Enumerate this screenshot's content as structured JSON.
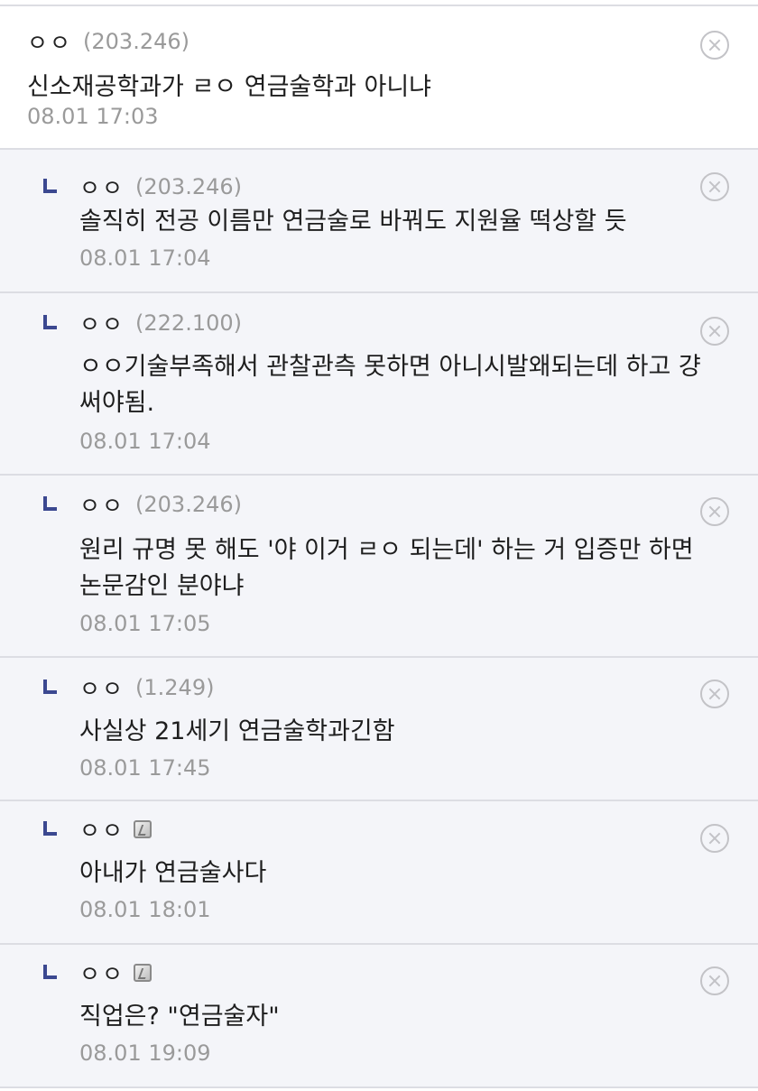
{
  "comments": [
    {
      "type": "top",
      "nick": "ㅇㅇ",
      "ip": "(203.246)",
      "text": "신소재공학과가 ㄹㅇ 연금술학과 아니냐",
      "date": "08.01 17:03"
    },
    {
      "type": "reply",
      "nick": "ㅇㅇ",
      "ip": "(203.246)",
      "text": "솔직히 전공 이름만 연금술로 바꿔도 지원율 떡상할 듯",
      "date": "08.01 17:04"
    },
    {
      "type": "reply",
      "nick": "ㅇㅇ",
      "ip": "(222.100)",
      "text": "ㅇㅇ기술부족해서 관찰관측 못하면 아니시발왜되는데 하고 걍 써야됨.",
      "date": "08.01 17:04"
    },
    {
      "type": "reply",
      "nick": "ㅇㅇ",
      "ip": "(203.246)",
      "text": "원리 규명 못 해도 '야 이거 ㄹㅇ 되는데' 하는 거 입증만 하면 논문감인 분야냐",
      "date": "08.01 17:05"
    },
    {
      "type": "reply",
      "nick": "ㅇㅇ",
      "ip": "(1.249)",
      "text": "사실상 21세기 연금술학과긴함",
      "date": "08.01 17:45"
    },
    {
      "type": "reply",
      "nick": "ㅇㅇ",
      "ip": "",
      "badge": "fixed-nick-icon",
      "text": "아내가 연금술사다",
      "date": "08.01 18:01"
    },
    {
      "type": "reply",
      "nick": "ㅇㅇ",
      "ip": "",
      "badge": "fixed-nick-icon",
      "text": "직업은? \"연금술자\"",
      "date": "08.01 19:09"
    }
  ],
  "colors": {
    "reply_background": "#f4f5f9",
    "reply_marker": "#3b4890",
    "meta_text": "#9a9a9a"
  }
}
